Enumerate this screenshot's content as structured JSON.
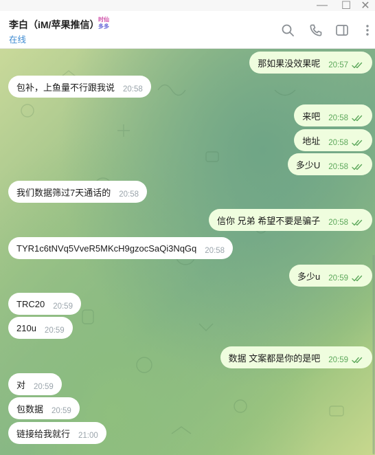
{
  "window": {
    "minimize_glyph": "—",
    "maximize_glyph": "☐",
    "close_glyph": "✕"
  },
  "header": {
    "name": "李白（iM/苹果推信）",
    "status": "在线",
    "badge_line1": "时仙",
    "badge_line2": "多多",
    "icons": [
      "search-icon",
      "phone-icon",
      "sidebar-toggle-icon",
      "more-icon"
    ]
  },
  "messages": [
    {
      "dir": "out",
      "text": "那如果没效果呢",
      "time": "20:57"
    },
    {
      "dir": "in",
      "text": "包补，上鱼量不行跟我说",
      "time": "20:58"
    },
    {
      "dir": "out",
      "text": "来吧",
      "time": "20:58"
    },
    {
      "dir": "out",
      "text": "地址",
      "time": "20:58"
    },
    {
      "dir": "out",
      "text": "多少U",
      "time": "20:58"
    },
    {
      "dir": "in",
      "text": "我们数据筛过7天通话的",
      "time": "20:58"
    },
    {
      "dir": "out",
      "text": "信你  兄弟  希望不要是骗子",
      "time": "20:58"
    },
    {
      "dir": "in",
      "text": "TYR1c6tNVq5VveR5MKcH9gzocSaQi3NqGq",
      "time": "20:58"
    },
    {
      "dir": "out",
      "text": "多少u",
      "time": "20:59"
    },
    {
      "dir": "in",
      "text": "TRC20",
      "time": "20:59"
    },
    {
      "dir": "in",
      "text": "210u",
      "time": "20:59"
    },
    {
      "dir": "out",
      "text": "数据 文案都是你的是吧",
      "time": "20:59"
    },
    {
      "dir": "in",
      "text": "对",
      "time": "20:59"
    },
    {
      "dir": "in",
      "text": "包数据",
      "time": "20:59"
    },
    {
      "dir": "in",
      "text": "链接给我就行",
      "time": "21:00"
    }
  ],
  "colors": {
    "incoming": "#ffffff",
    "outgoing": "#effdde",
    "status": "#3d8ad1",
    "read_ticks": "#5da85b"
  }
}
